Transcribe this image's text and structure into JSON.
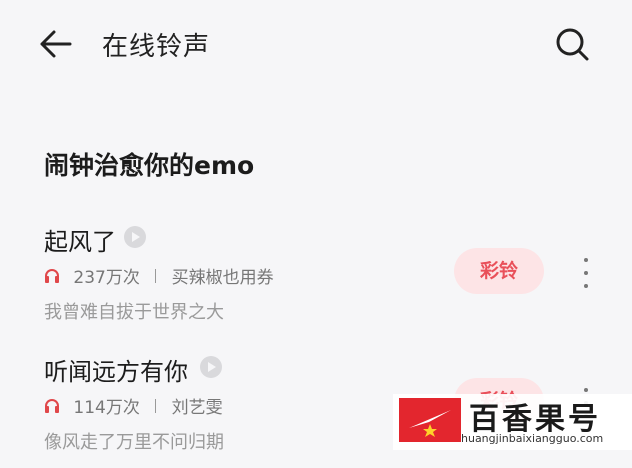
{
  "header": {
    "title": "在线铃声",
    "back_icon": "arrow-left-icon",
    "search_icon": "search-icon"
  },
  "section": {
    "title": "闹钟治愈你的emo"
  },
  "songs": [
    {
      "title": "起风了",
      "plays": "237万次",
      "artist": "买辣椒也用券",
      "lyric": "我曾难自拔于世界之大",
      "ringback_label": "彩铃"
    },
    {
      "title": "听闻远方有你",
      "plays": "114万次",
      "artist": "刘艺雯",
      "lyric": "像风走了万里不问归期",
      "ringback_label": "彩铃"
    }
  ],
  "colors": {
    "accent": "#e9505a",
    "accent_bg": "#fde4e6",
    "background": "#f6f6f8"
  },
  "watermark": {
    "text": "百香果号",
    "url": "huangjinbaixiangguo.com"
  }
}
